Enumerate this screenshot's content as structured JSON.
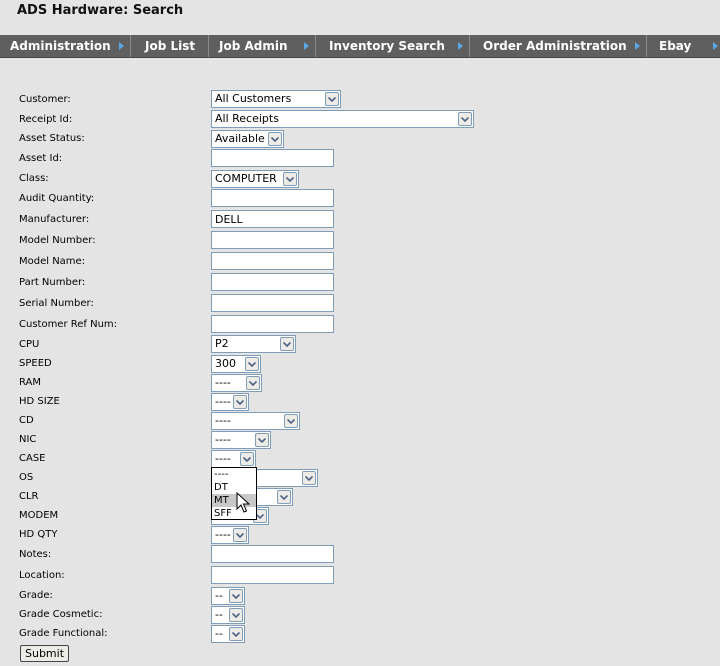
{
  "page_title": "ADS Hardware: Search",
  "nav": [
    {
      "label": "Administration",
      "arrow": true
    },
    {
      "label": "Job List",
      "arrow": false
    },
    {
      "label": "Job Admin",
      "arrow": true
    },
    {
      "label": "Inventory Search",
      "arrow": true
    },
    {
      "label": "Order Administration",
      "arrow": true
    },
    {
      "label": "Ebay",
      "arrow": true
    }
  ],
  "form": {
    "customer": {
      "label": "Customer:",
      "value": "All Customers"
    },
    "receipt_id": {
      "label": "Receipt Id:",
      "value": "All Receipts"
    },
    "asset_status": {
      "label": "Asset Status:",
      "value": "Available"
    },
    "asset_id": {
      "label": "Asset Id:",
      "value": ""
    },
    "class": {
      "label": "Class:",
      "value": "COMPUTER"
    },
    "audit_quantity": {
      "label": "Audit Quantity:",
      "value": ""
    },
    "manufacturer": {
      "label": "Manufacturer:",
      "value": "DELL"
    },
    "model_number": {
      "label": "Model Number:",
      "value": ""
    },
    "model_name": {
      "label": "Model Name:",
      "value": ""
    },
    "part_number": {
      "label": "Part Number:",
      "value": ""
    },
    "serial_number": {
      "label": "Serial Number:",
      "value": ""
    },
    "customer_ref_num": {
      "label": "Customer Ref Num:",
      "value": ""
    },
    "cpu": {
      "label": "CPU",
      "value": "P2"
    },
    "speed": {
      "label": "SPEED",
      "value": "300"
    },
    "ram": {
      "label": "RAM",
      "value": "----"
    },
    "hd_size": {
      "label": "HD SIZE",
      "value": "----"
    },
    "cd": {
      "label": "CD",
      "value": "----"
    },
    "nic": {
      "label": "NIC",
      "value": "----"
    },
    "case": {
      "label": "CASE",
      "value": "----"
    },
    "os": {
      "label": "OS",
      "value": ""
    },
    "clr": {
      "label": "CLR",
      "value": ""
    },
    "modem": {
      "label": "MODEM",
      "value": ""
    },
    "hd_qty": {
      "label": "HD QTY",
      "value": "----"
    },
    "notes": {
      "label": "Notes:",
      "value": ""
    },
    "location": {
      "label": "Location:",
      "value": ""
    },
    "grade": {
      "label": "Grade:",
      "value": "--"
    },
    "grade_cosmetic": {
      "label": "Grade Cosmetic:",
      "value": "--"
    },
    "grade_functional": {
      "label": "Grade Functional:",
      "value": "--"
    }
  },
  "case_dropdown_options": [
    "----",
    "DT",
    "MT",
    "SFF"
  ],
  "case_dropdown_highlighted": "MT",
  "submit_label": "Submit"
}
